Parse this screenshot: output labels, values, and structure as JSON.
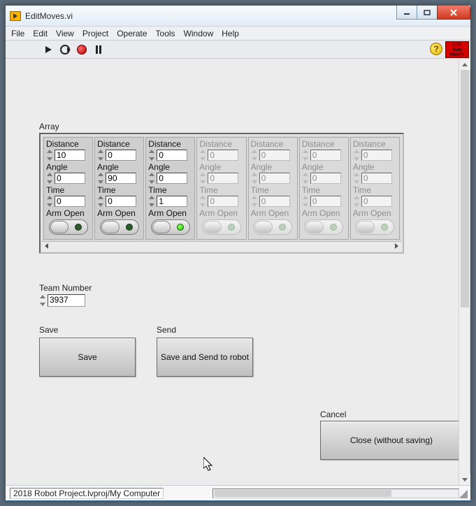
{
  "window": {
    "title": "EditMoves.vi"
  },
  "menu": {
    "file": "File",
    "edit": "Edit",
    "view": "View",
    "project": "Project",
    "operate": "Operate",
    "tools": "Tools",
    "window": "Window",
    "help": "Help"
  },
  "toolbar": {
    "help_glyph": "?",
    "editauto_line1": "Edit",
    "editauto_line2": "Auto",
    "editauto_line3": "Moves"
  },
  "array": {
    "label": "Array",
    "field_labels": {
      "distance": "Distance",
      "angle": "Angle",
      "time": "Time",
      "arm_open": "Arm Open"
    },
    "items": [
      {
        "active": true,
        "distance": "10",
        "angle": "0",
        "time": "0",
        "arm_open": false
      },
      {
        "active": true,
        "distance": "0",
        "angle": "90",
        "time": "0",
        "arm_open": false
      },
      {
        "active": true,
        "distance": "0",
        "angle": "0",
        "time": "1",
        "arm_open": true
      },
      {
        "active": false,
        "distance": "0",
        "angle": "0",
        "time": "0",
        "arm_open": false
      },
      {
        "active": false,
        "distance": "0",
        "angle": "0",
        "time": "0",
        "arm_open": false
      },
      {
        "active": false,
        "distance": "0",
        "angle": "0",
        "time": "0",
        "arm_open": false
      },
      {
        "active": false,
        "distance": "0",
        "angle": "0",
        "time": "0",
        "arm_open": false
      }
    ]
  },
  "team": {
    "label": "Team Number",
    "value": "3937"
  },
  "buttons": {
    "save_label": "Save",
    "save_btn": "Save",
    "send_label": "Send",
    "send_btn": "Save and Send to robot",
    "cancel_label": "Cancel",
    "cancel_btn": "Close (without saving)"
  },
  "status": {
    "path": "2018 Robot Project.lvproj/My Computer"
  }
}
